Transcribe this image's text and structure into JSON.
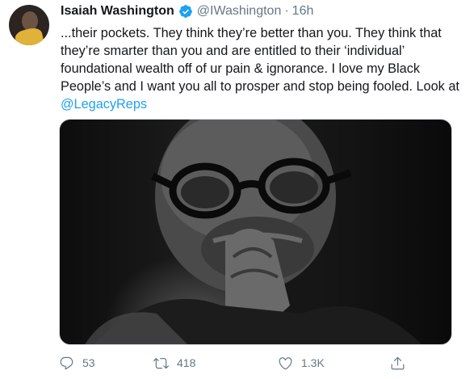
{
  "tweet": {
    "author_name": "Isaiah Washington",
    "handle": "@IWashington",
    "separator": "·",
    "time": "16h",
    "text_lines": [
      "...their pockets. They think they’re better than you. They think that",
      "they’re smarter than you and are entitled to their ‘individual’",
      "foundational wealth off of ur pain & ignorance. I love my Black",
      "People’s and I want you all to prosper and stop being fooled. Look at"
    ],
    "mention": "@LegacyReps"
  },
  "actions": {
    "reply_count": "53",
    "retweet_count": "418",
    "like_count": "1.3K"
  },
  "colors": {
    "link": "#1da1f2",
    "muted": "#657786",
    "text": "#14171a"
  },
  "icons": [
    "verified-badge-icon",
    "reply-icon",
    "retweet-icon",
    "like-icon",
    "share-icon"
  ]
}
